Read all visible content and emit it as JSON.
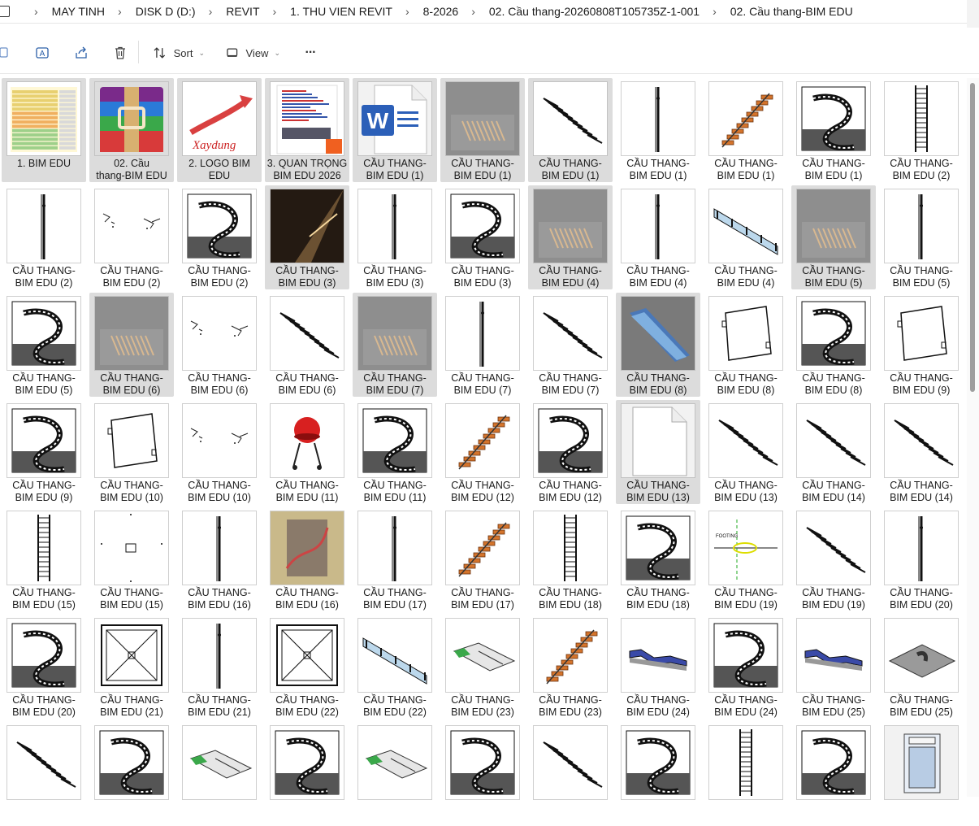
{
  "breadcrumb": [
    "MAY TINH",
    "DISK D (D:)",
    "REVIT",
    "1. THU VIEN REVIT",
    "8-2026",
    "02. Cầu thang-20260808T105735Z-1-001",
    "02. Cầu thang-BIM EDU"
  ],
  "toolbar": {
    "sort_label": "Sort",
    "view_label": "View",
    "more_label": "···"
  },
  "icons": {
    "copy": "copy-icon",
    "rename": "rename-icon",
    "share": "share-icon",
    "delete": "delete-icon",
    "sort": "sort-icon",
    "view": "view-icon",
    "more": "more-icon"
  },
  "colors": {
    "accent": "#2b7cd3",
    "selected_tile": "#dcdcdc"
  },
  "files": [
    {
      "line1": "1. BIM EDU",
      "line2": "",
      "thumb": "sheet"
    },
    {
      "line1": "02. Cầu",
      "line2": "thang-BIM EDU",
      "thumb": "winrar"
    },
    {
      "line1": "2. LOGO BIM",
      "line2": "EDU",
      "thumb": "logo"
    },
    {
      "line1": "3. QUAN TRỌNG",
      "line2": "BIM EDU 2026",
      "thumb": "doc"
    },
    {
      "line1": "CẦU THANG-",
      "line2": "BIM EDU (1)",
      "thumb": "word"
    },
    {
      "line1": "CẦU THANG-",
      "line2": "BIM EDU (1)",
      "thumb": "grey"
    },
    {
      "line1": "CẦU THANG-",
      "line2": "BIM EDU (1)",
      "thumb": "stair"
    },
    {
      "line1": "CẦU THANG-",
      "line2": "BIM EDU (1)",
      "thumb": "pole"
    },
    {
      "line1": "CẦU THANG-",
      "line2": "BIM EDU (1)",
      "thumb": "orange"
    },
    {
      "line1": "CẦU THANG-",
      "line2": "BIM EDU (1)",
      "thumb": "spiral"
    },
    {
      "line1": "CẦU THANG-",
      "line2": "BIM EDU (2)",
      "thumb": "ladder"
    },
    {
      "line1": "CẦU THANG-",
      "line2": "BIM EDU (2)",
      "thumb": "pole"
    },
    {
      "line1": "CẦU THANG-",
      "line2": "BIM EDU (2)",
      "thumb": "sketch"
    },
    {
      "line1": "CẦU THANG-",
      "line2": "BIM EDU (2)",
      "thumb": "spiral"
    },
    {
      "line1": "CẦU THANG-",
      "line2": "BIM EDU (3)",
      "thumb": "dark"
    },
    {
      "line1": "CẦU THANG-",
      "line2": "BIM EDU (3)",
      "thumb": "pole"
    },
    {
      "line1": "CẦU THANG-",
      "line2": "BIM EDU (3)",
      "thumb": "spiral"
    },
    {
      "line1": "CẦU THANG-",
      "line2": "BIM EDU (4)",
      "thumb": "grey"
    },
    {
      "line1": "CẦU THANG-",
      "line2": "BIM EDU (4)",
      "thumb": "pole"
    },
    {
      "line1": "CẦU THANG-",
      "line2": "BIM EDU (4)",
      "thumb": "glass"
    },
    {
      "line1": "CẦU THANG-",
      "line2": "BIM EDU (5)",
      "thumb": "grey"
    },
    {
      "line1": "CẦU THANG-",
      "line2": "BIM EDU (5)",
      "thumb": "pole"
    },
    {
      "line1": "CẦU THANG-",
      "line2": "BIM EDU (5)",
      "thumb": "spiral"
    },
    {
      "line1": "CẦU THANG-",
      "line2": "BIM EDU (6)",
      "thumb": "grey"
    },
    {
      "line1": "CẦU THANG-",
      "line2": "BIM EDU (6)",
      "thumb": "sketch"
    },
    {
      "line1": "CẦU THANG-",
      "line2": "BIM EDU (6)",
      "thumb": "stair"
    },
    {
      "line1": "CẦU THANG-",
      "line2": "BIM EDU (7)",
      "thumb": "grey"
    },
    {
      "line1": "CẦU THANG-",
      "line2": "BIM EDU (7)",
      "thumb": "pole"
    },
    {
      "line1": "CẦU THANG-",
      "line2": "BIM EDU (7)",
      "thumb": "stair"
    },
    {
      "line1": "CẦU THANG-",
      "line2": "BIM EDU (8)",
      "thumb": "escal"
    },
    {
      "line1": "CẦU THANG-",
      "line2": "BIM EDU (8)",
      "thumb": "frame"
    },
    {
      "line1": "CẦU THANG-",
      "line2": "BIM EDU (8)",
      "thumb": "spiral"
    },
    {
      "line1": "CẦU THANG-",
      "line2": "BIM EDU (9)",
      "thumb": "frame"
    },
    {
      "line1": "CẦU THANG-",
      "line2": "BIM EDU (9)",
      "thumb": "spiral"
    },
    {
      "line1": "CẦU THANG-",
      "line2": "BIM EDU (10)",
      "thumb": "frame"
    },
    {
      "line1": "CẦU THANG-",
      "line2": "BIM EDU (10)",
      "thumb": "sketch"
    },
    {
      "line1": "CẦU THANG-",
      "line2": "BIM EDU (11)",
      "thumb": "bbq"
    },
    {
      "line1": "CẦU THANG-",
      "line2": "BIM EDU (11)",
      "thumb": "spiral"
    },
    {
      "line1": "CẦU THANG-",
      "line2": "BIM EDU (12)",
      "thumb": "orange"
    },
    {
      "line1": "CẦU THANG-",
      "line2": "BIM EDU (12)",
      "thumb": "spiral"
    },
    {
      "line1": "CẦU THANG-",
      "line2": "BIM EDU (13)",
      "thumb": "blank"
    },
    {
      "line1": "CẦU THANG-",
      "line2": "BIM EDU (13)",
      "thumb": "stair"
    },
    {
      "line1": "CẦU THANG-",
      "line2": "BIM EDU (14)",
      "thumb": "stair"
    },
    {
      "line1": "CẦU THANG-",
      "line2": "BIM EDU (14)",
      "thumb": "stair"
    },
    {
      "line1": "CẦU THANG-",
      "line2": "BIM EDU (15)",
      "thumb": "ladder"
    },
    {
      "line1": "CẦU THANG-",
      "line2": "BIM EDU (15)",
      "thumb": "dots"
    },
    {
      "line1": "CẦU THANG-",
      "line2": "BIM EDU (16)",
      "thumb": "pole"
    },
    {
      "line1": "CẦU THANG-",
      "line2": "BIM EDU (16)",
      "thumb": "photo"
    },
    {
      "line1": "CẦU THANG-",
      "line2": "BIM EDU (17)",
      "thumb": "pole"
    },
    {
      "line1": "CẦU THANG-",
      "line2": "BIM EDU (17)",
      "thumb": "orange"
    },
    {
      "line1": "CẦU THANG-",
      "line2": "BIM EDU (18)",
      "thumb": "ladder"
    },
    {
      "line1": "CẦU THANG-",
      "line2": "BIM EDU (18)",
      "thumb": "spiral"
    },
    {
      "line1": "CẦU THANG-",
      "line2": "BIM EDU (19)",
      "thumb": "plan"
    },
    {
      "line1": "CẦU THANG-",
      "line2": "BIM EDU (19)",
      "thumb": "stair"
    },
    {
      "line1": "CẦU THANG-",
      "line2": "BIM EDU (20)",
      "thumb": "pole"
    },
    {
      "line1": "CẦU THANG-",
      "line2": "BIM EDU (20)",
      "thumb": "spiral"
    },
    {
      "line1": "CẦU THANG-",
      "line2": "BIM EDU (21)",
      "thumb": "xbox"
    },
    {
      "line1": "CẦU THANG-",
      "line2": "BIM EDU (21)",
      "thumb": "pole"
    },
    {
      "line1": "CẦU THANG-",
      "line2": "BIM EDU (22)",
      "thumb": "xbox"
    },
    {
      "line1": "CẦU THANG-",
      "line2": "BIM EDU (22)",
      "thumb": "glass"
    },
    {
      "line1": "CẦU THANG-",
      "line2": "BIM EDU (23)",
      "thumb": "green"
    },
    {
      "line1": "CẦU THANG-",
      "line2": "BIM EDU (23)",
      "thumb": "orange"
    },
    {
      "line1": "CẦU THANG-",
      "line2": "BIM EDU (24)",
      "thumb": "blue"
    },
    {
      "line1": "CẦU THANG-",
      "line2": "BIM EDU (24)",
      "thumb": "spiral"
    },
    {
      "line1": "CẦU THANG-",
      "line2": "BIM EDU (25)",
      "thumb": "blue"
    },
    {
      "line1": "CẦU THANG-",
      "line2": "BIM EDU (25)",
      "thumb": "plate"
    },
    {
      "line1": "",
      "line2": "",
      "thumb": "stair"
    },
    {
      "line1": "",
      "line2": "",
      "thumb": "spiral"
    },
    {
      "line1": "",
      "line2": "",
      "thumb": "green"
    },
    {
      "line1": "",
      "line2": "",
      "thumb": "spiral"
    },
    {
      "line1": "",
      "line2": "",
      "thumb": "green"
    },
    {
      "line1": "",
      "line2": "",
      "thumb": "spiral"
    },
    {
      "line1": "",
      "line2": "",
      "thumb": "stair"
    },
    {
      "line1": "",
      "line2": "",
      "thumb": "spiral"
    },
    {
      "line1": "",
      "line2": "",
      "thumb": "ladder"
    },
    {
      "line1": "",
      "line2": "",
      "thumb": "spiral"
    },
    {
      "line1": "",
      "line2": "",
      "thumb": "elevator"
    }
  ],
  "selected_indices": [
    0,
    1,
    2,
    3,
    4,
    5,
    6,
    14,
    17,
    20,
    23,
    26,
    29,
    40
  ]
}
